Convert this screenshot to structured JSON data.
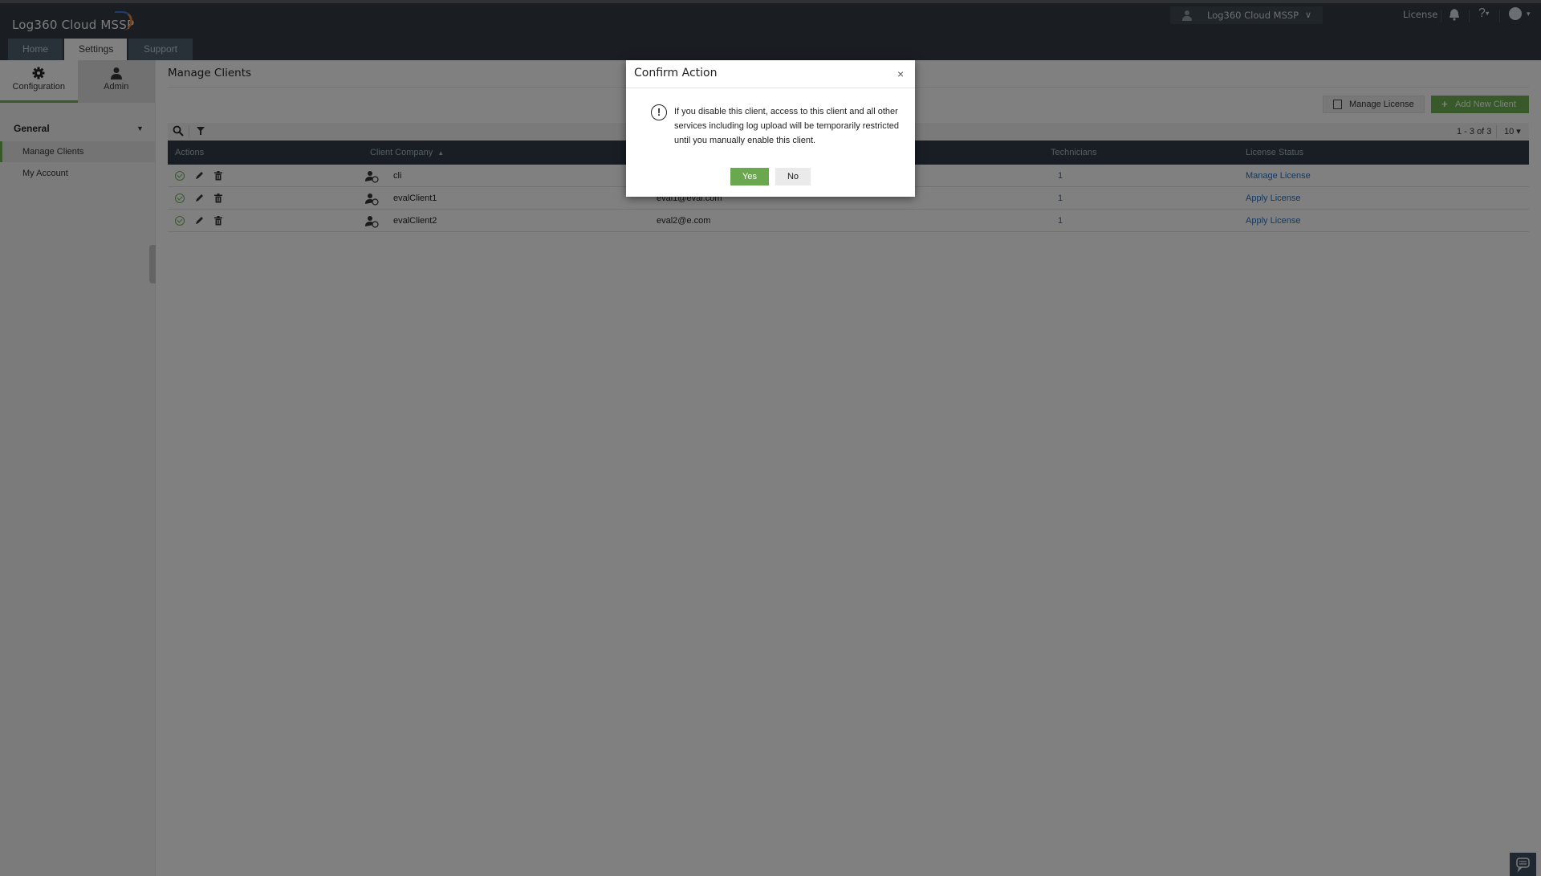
{
  "app": {
    "logo_text": "Log360 Cloud MSSP",
    "nav_tabs": [
      {
        "label": "Home",
        "active": false
      },
      {
        "label": "Settings",
        "active": true
      },
      {
        "label": "Support",
        "active": false
      }
    ],
    "org_switcher": {
      "label": "Log360 Cloud MSSP",
      "icon": "user-tie-icon"
    },
    "header_links": {
      "license": "License",
      "help": "?"
    },
    "icons": {
      "bell": "bell-icon",
      "help": "help-icon",
      "user": "user-circle-icon",
      "chat": "chat-icon"
    }
  },
  "sidebar": {
    "tabs": [
      {
        "label": "Configuration",
        "icon": "gear-icon",
        "active": true
      },
      {
        "label": "Admin",
        "icon": "admin-user-icon",
        "active": false
      }
    ],
    "group": "General",
    "items": [
      {
        "label": "Manage Clients",
        "active": true
      },
      {
        "label": "My Account",
        "active": false
      }
    ]
  },
  "main": {
    "title": "Manage Clients",
    "buttons": {
      "manage_license": "Manage License",
      "add_new_client": "Add New Client"
    },
    "pager": {
      "range": "1 - 3 of 3",
      "page_size": "10"
    },
    "columns": [
      "Actions",
      "Client Company",
      "",
      "Technicians",
      "License Status"
    ],
    "sorted_column": "Client Company",
    "rows": [
      {
        "company": "cli",
        "company_icon": "client-licensed-icon",
        "email": "",
        "technicians": "1",
        "license_status": "Manage License"
      },
      {
        "company": "evalClient1",
        "company_icon": "client-trial-icon",
        "email": "eval1@eval.com",
        "technicians": "1",
        "license_status": "Apply License"
      },
      {
        "company": "evalClient2",
        "company_icon": "client-trial-icon",
        "email": "eval2@e.com",
        "technicians": "1",
        "license_status": "Apply License"
      }
    ]
  },
  "modal": {
    "title": "Confirm Action",
    "message": "If you disable this client, access to this client and all other services including log upload will be temporarily restricted until you manually enable this client.",
    "yes": "Yes",
    "no": "No",
    "close": "×",
    "warning_glyph": "!"
  }
}
